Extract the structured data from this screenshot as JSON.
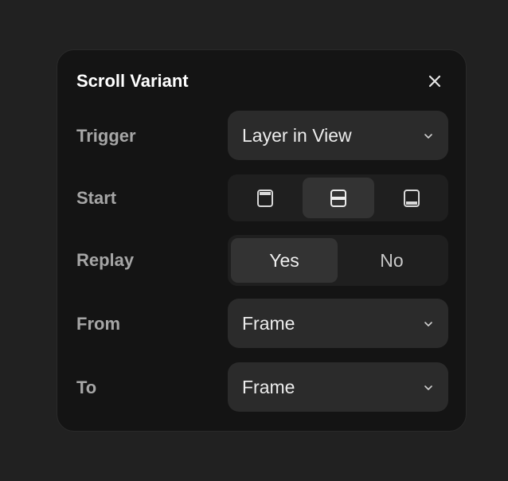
{
  "panel": {
    "title": "Scroll Variant",
    "close_icon": "close-icon"
  },
  "trigger": {
    "label": "Trigger",
    "value": "Layer in View",
    "icon": "chevron-down-icon"
  },
  "start": {
    "label": "Start",
    "options": [
      {
        "icon": "align-top-icon",
        "selected": false
      },
      {
        "icon": "align-center-icon",
        "selected": true
      },
      {
        "icon": "align-bottom-icon",
        "selected": false
      }
    ]
  },
  "replay": {
    "label": "Replay",
    "options": [
      {
        "label": "Yes",
        "selected": true
      },
      {
        "label": "No",
        "selected": false
      }
    ]
  },
  "from": {
    "label": "From",
    "value": "Frame",
    "icon": "chevron-down-icon"
  },
  "to": {
    "label": "To",
    "value": "Frame",
    "icon": "chevron-down-icon"
  },
  "colors": {
    "background": "#212121",
    "panel": "#141414",
    "control": "#2b2b2b",
    "selected": "#333333",
    "label": "#a6a6a6",
    "text": "#ececec"
  }
}
